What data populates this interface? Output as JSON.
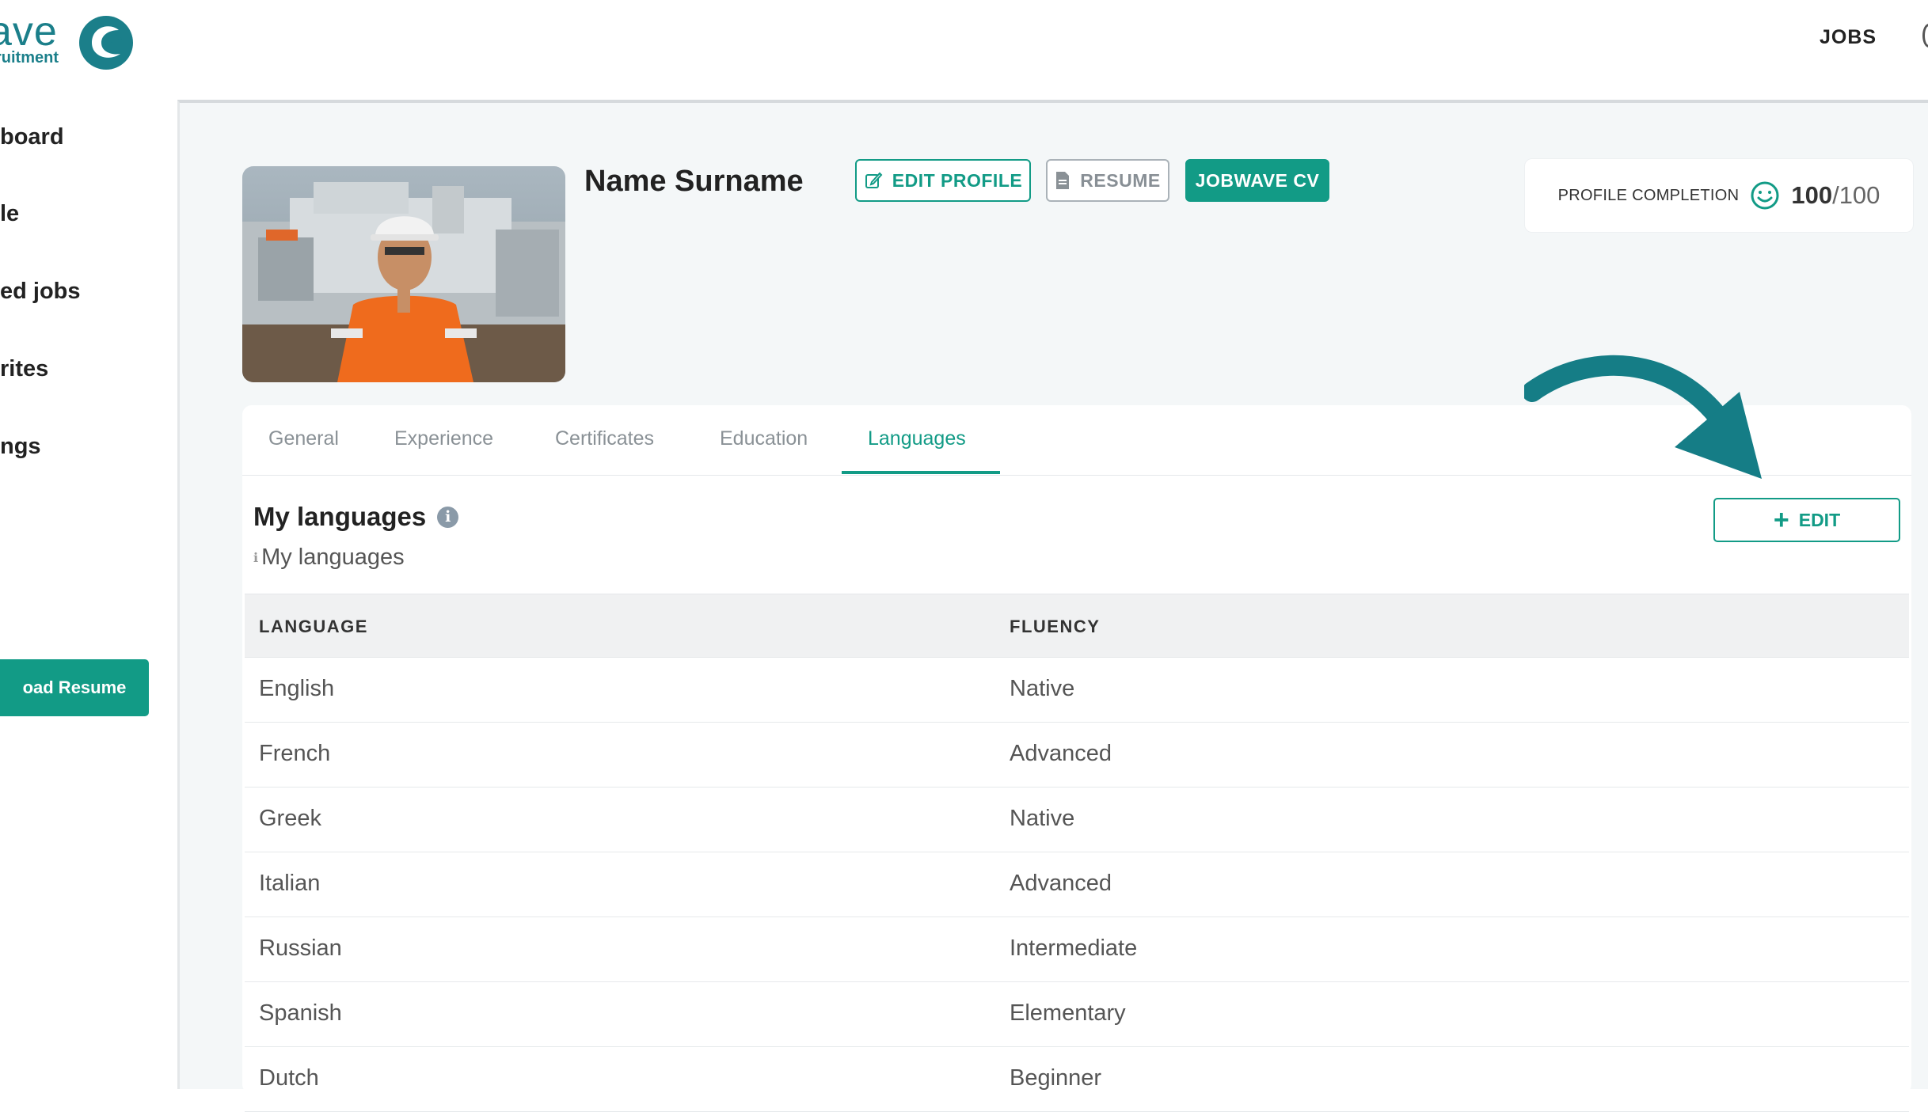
{
  "brand": {
    "word": "ave",
    "sub": "ruitment",
    "accent": "#129b86"
  },
  "nav": {
    "jobs": "JOBS"
  },
  "sidebar": {
    "items": [
      {
        "label": "board"
      },
      {
        "label": "le"
      },
      {
        "label": "ed jobs"
      },
      {
        "label": "rites"
      },
      {
        "label": "ngs"
      }
    ],
    "upload_label": "oad Resume"
  },
  "profile": {
    "name": "Name Surname",
    "edit_profile": "EDIT PROFILE",
    "resume": "RESUME",
    "jobwave_cv": "JOBWAVE CV",
    "completion_label": "PROFILE COMPLETION",
    "completion_score": "100",
    "completion_max": "/100"
  },
  "tabs": [
    {
      "label": "General"
    },
    {
      "label": "Experience"
    },
    {
      "label": "Certificates"
    },
    {
      "label": "Education"
    },
    {
      "label": "Languages"
    }
  ],
  "active_tab": "Languages",
  "languages": {
    "title": "My languages",
    "subtitle": "My languages",
    "edit_label": "EDIT",
    "columns": [
      "LANGUAGE",
      "FLUENCY"
    ],
    "rows": [
      [
        "English",
        "Native"
      ],
      [
        "French",
        "Advanced"
      ],
      [
        "Greek",
        "Native"
      ],
      [
        "Italian",
        "Advanced"
      ],
      [
        "Russian",
        "Intermediate"
      ],
      [
        "Spanish",
        "Elementary"
      ],
      [
        "Dutch",
        "Beginner"
      ]
    ]
  }
}
